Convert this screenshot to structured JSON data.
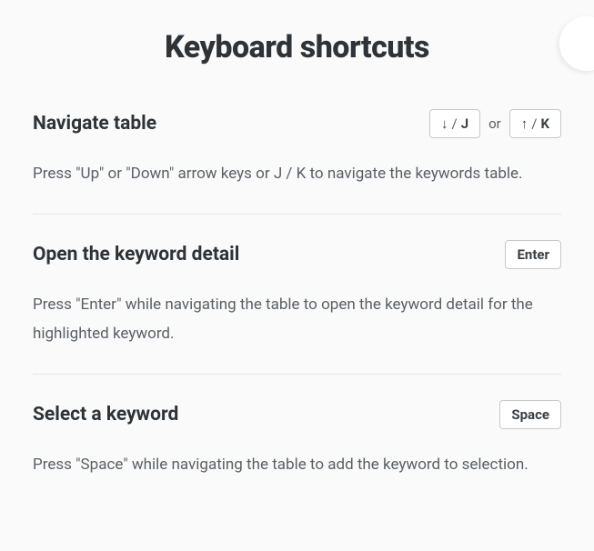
{
  "title": "Keyboard shortcuts",
  "sections": [
    {
      "heading": "Navigate table",
      "description": "Press \"Up\" or \"Down\" arrow keys or J / K to navigate the keywords table.",
      "keys": {
        "box1_arrow": "↓",
        "box1_sep": "/",
        "box1_letter": "J",
        "joiner": "or",
        "box2_arrow": "↑",
        "box2_sep": "/",
        "box2_letter": "K"
      }
    },
    {
      "heading": "Open the keyword detail",
      "description": "Press \"Enter\" while navigating the table to open the keyword detail for the highlighted keyword.",
      "keys": {
        "single": "Enter"
      }
    },
    {
      "heading": "Select a keyword",
      "description": "Press \"Space\" while navigating the table to add the keyword to selection.",
      "keys": {
        "single": "Space"
      }
    }
  ]
}
